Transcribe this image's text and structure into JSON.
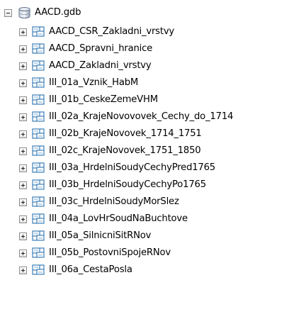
{
  "tree": {
    "root": {
      "label": "AACD.gdb",
      "expanded": true,
      "icon": "geodatabase-icon"
    },
    "children": [
      {
        "label": "AACD_CSR_Zakladni_vrstvy",
        "icon": "feature-dataset-icon",
        "expanded": false
      },
      {
        "label": "AACD_Spravni_hranice",
        "icon": "feature-dataset-icon",
        "expanded": false
      },
      {
        "label": "AACD_Zakladni_vrstvy",
        "icon": "feature-dataset-icon",
        "expanded": false
      },
      {
        "label": "III_01a_Vznik_HabM",
        "icon": "feature-dataset-icon",
        "expanded": false
      },
      {
        "label": "III_01b_CeskeZemeVHM",
        "icon": "feature-dataset-icon",
        "expanded": false
      },
      {
        "label": "III_02a_KrajeNovovovek_Cechy_do_1714",
        "icon": "feature-dataset-icon",
        "expanded": false
      },
      {
        "label": "III_02b_KrajeNovovek_1714_1751",
        "icon": "feature-dataset-icon",
        "expanded": false
      },
      {
        "label": "III_02c_KrajeNovovek_1751_1850",
        "icon": "feature-dataset-icon",
        "expanded": false
      },
      {
        "label": "III_03a_HrdelniSoudyCechyPred1765",
        "icon": "feature-dataset-icon",
        "expanded": false
      },
      {
        "label": "III_03b_HrdelniSoudyCechyPo1765",
        "icon": "feature-dataset-icon",
        "expanded": false
      },
      {
        "label": "III_03c_HrdelniSoudyMorSlez",
        "icon": "feature-dataset-icon",
        "expanded": false
      },
      {
        "label": "III_04a_LovHrSoudNaBuchtove",
        "icon": "feature-dataset-icon",
        "expanded": false
      },
      {
        "label": "III_05a_SilnicniSitRNov",
        "icon": "feature-dataset-icon",
        "expanded": false
      },
      {
        "label": "III_05b_PostovniSpojeRNov",
        "icon": "feature-dataset-icon",
        "expanded": false
      },
      {
        "label": "III_06a_CestaPosla",
        "icon": "feature-dataset-icon",
        "expanded": false
      }
    ]
  }
}
